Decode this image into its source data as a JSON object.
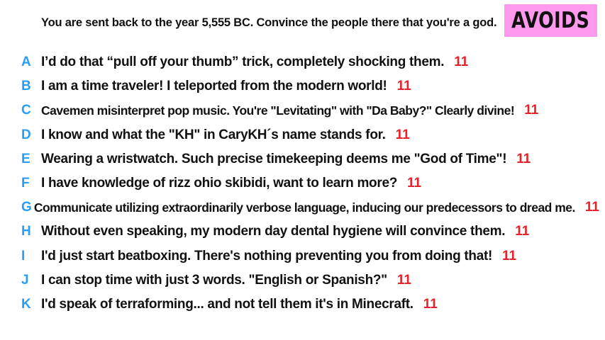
{
  "prompt": "You are sent back to the year 5,555 BC. Convince the people there that you're a god.",
  "badge": {
    "label": "AVOIDS",
    "color": "#ff99ee"
  },
  "colors": {
    "letter": "#2a9df4",
    "score": "#e8202a",
    "text": "#111111"
  },
  "answers": [
    {
      "letter": "A",
      "text": "I’d do that “pull off your thumb” trick, completely shocking them.",
      "score": "11"
    },
    {
      "letter": "B",
      "text": "I am a time traveler! I teleported from the modern world!",
      "score": "11"
    },
    {
      "letter": "C",
      "text": "Cavemen misinterpret pop music. You're \"Levitating\" with \"Da Baby?\" Clearly divine!",
      "score": "11"
    },
    {
      "letter": "D",
      "text": "I know and what the \"KH\" in CaryKH´s name stands for.",
      "score": "11"
    },
    {
      "letter": "E",
      "text": "Wearing a wristwatch. Such precise timekeeping deems me \"God of Time\"!",
      "score": "11"
    },
    {
      "letter": "F",
      "text": "I have knowledge of rizz ohio skibidi, want to learn more?",
      "score": "11"
    },
    {
      "letter": "G",
      "text": "Communicate utilizing extraordinarily verbose language, inducing our predecessors to dread me.",
      "score": "11"
    },
    {
      "letter": "H",
      "text": "Without even speaking, my modern day dental hygiene will convince them.",
      "score": "11"
    },
    {
      "letter": "I",
      "text": "I'd just start beatboxing. There's nothing preventing you from doing that!",
      "score": "11"
    },
    {
      "letter": "J",
      "text": "I can stop time with just 3 words. \"English or Spanish?\"",
      "score": "11"
    },
    {
      "letter": "K",
      "text": "I'd speak of terraforming... and not tell them it's in Minecraft.",
      "score": "11"
    }
  ]
}
